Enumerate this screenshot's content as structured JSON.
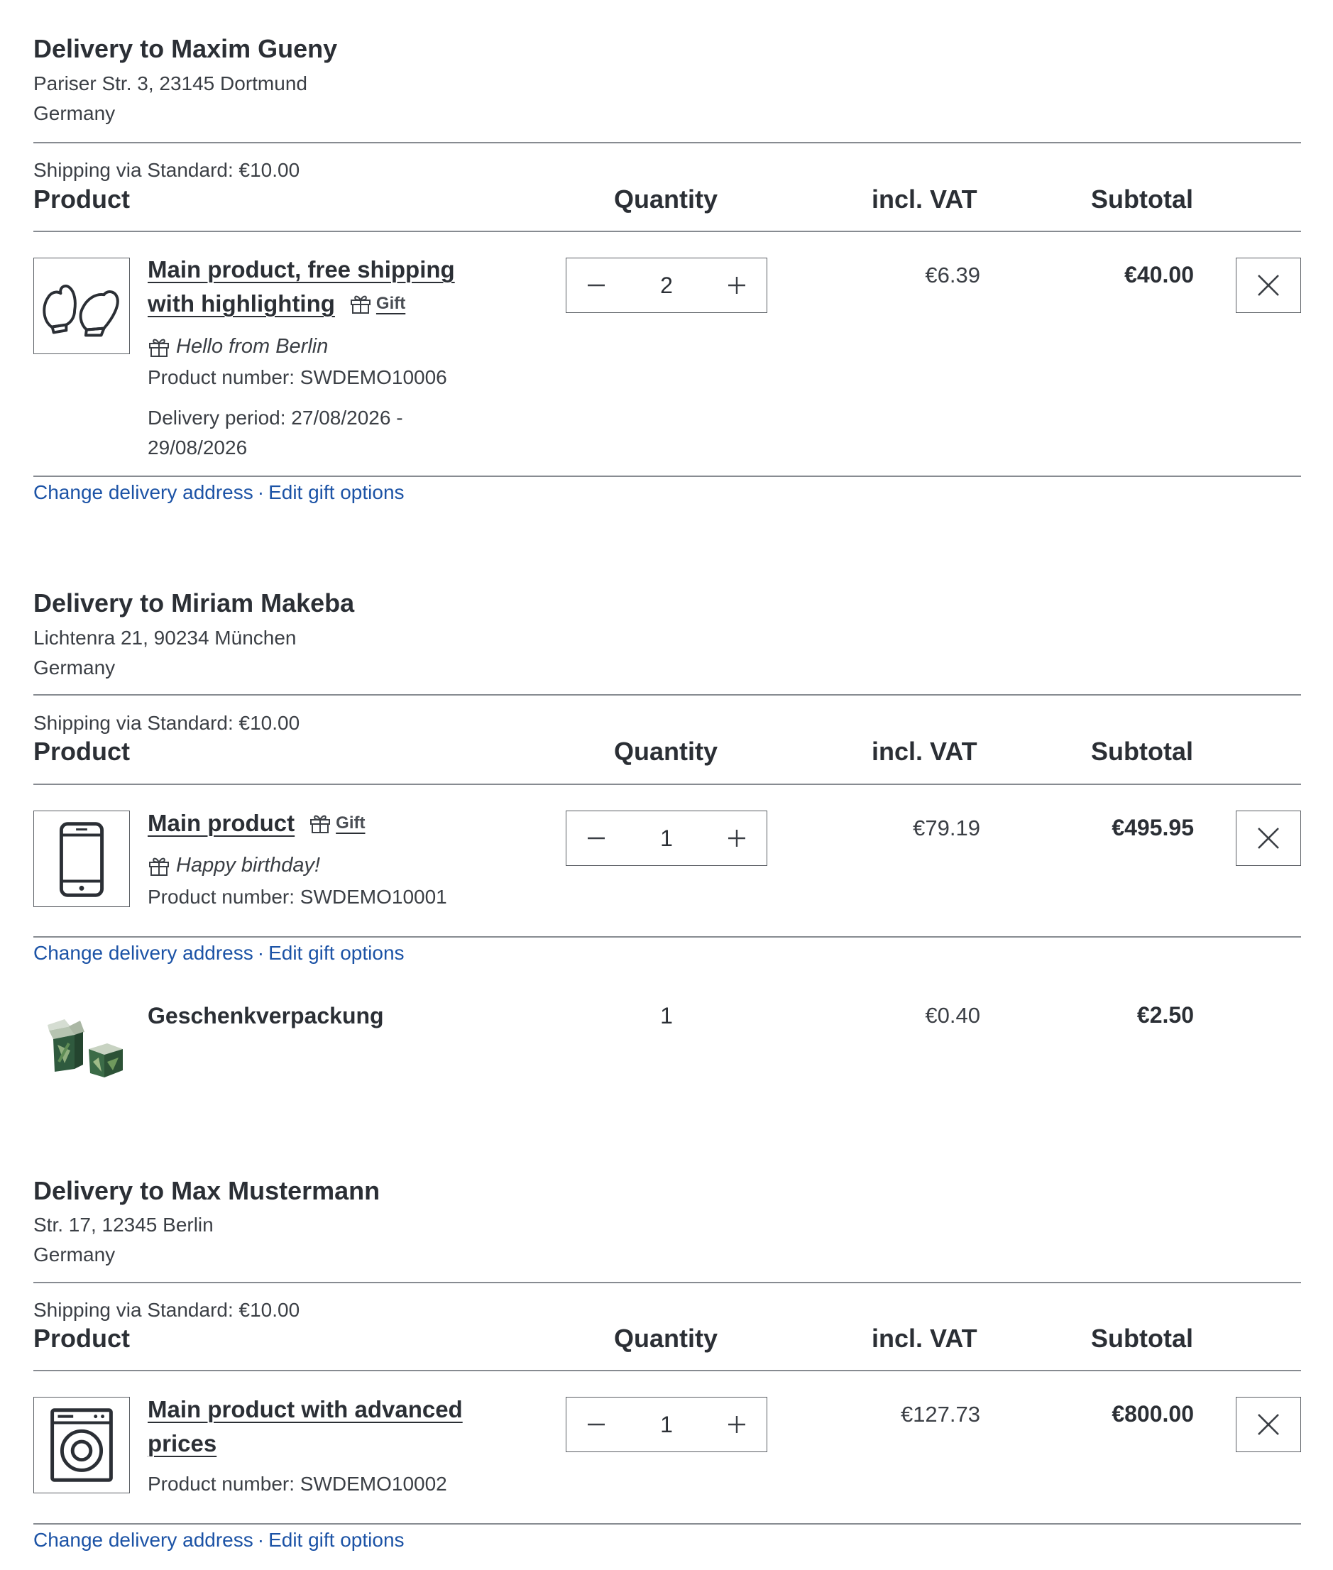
{
  "labels": {
    "shipping_line": "Shipping via Standard: €10.00",
    "col_product": "Product",
    "col_quantity": "Quantity",
    "col_vat": "incl. VAT",
    "col_subtotal": "Subtotal",
    "change_address": "Change delivery address",
    "link_separator": "·",
    "edit_gift": "Edit gift options",
    "gift_badge": "Gift"
  },
  "deliveries": [
    {
      "heading": "Delivery to Maxim Gueny",
      "address_line1": "Pariser Str. 3, 23145 Dortmund",
      "country": "Germany",
      "item": {
        "icon": "mittens-icon",
        "title_line1": "Main product, free shipping",
        "title_line2": "with highlighting",
        "gift_message": "Hello from Berlin",
        "product_number": "Product number: SWDEMO10006",
        "delivery_period": "Delivery period: 27/08/2026 - 29/08/2026",
        "quantity": "2",
        "vat": "€6.39",
        "subtotal": "€40.00"
      }
    },
    {
      "heading": "Delivery to Miriam Makeba",
      "address_line1": "Lichtenra 21, 90234 München",
      "country": "Germany",
      "item": {
        "icon": "smartphone-icon",
        "title": "Main product",
        "gift_message": "Happy birthday!",
        "product_number": "Product number: SWDEMO10001",
        "quantity": "1",
        "vat": "€79.19",
        "subtotal": "€495.95"
      },
      "wrapping": {
        "icon": "gift-boxes-image",
        "name": "Geschenkverpackung",
        "quantity": "1",
        "vat": "€0.40",
        "subtotal": "€2.50"
      }
    },
    {
      "heading": "Delivery to Max Mustermann",
      "address_line1": "Str. 17, 12345 Berlin",
      "country": "Germany",
      "item": {
        "icon": "washing-machine-icon",
        "title_line1": "Main product with advanced",
        "title_line2": "prices",
        "product_number": "Product number: SWDEMO10002",
        "quantity": "1",
        "vat": "€127.73",
        "subtotal": "€800.00"
      }
    }
  ],
  "colors": {
    "text": "#2b2f35",
    "link": "#1c53a6",
    "rule": "#878b91",
    "border": "#595d63"
  }
}
